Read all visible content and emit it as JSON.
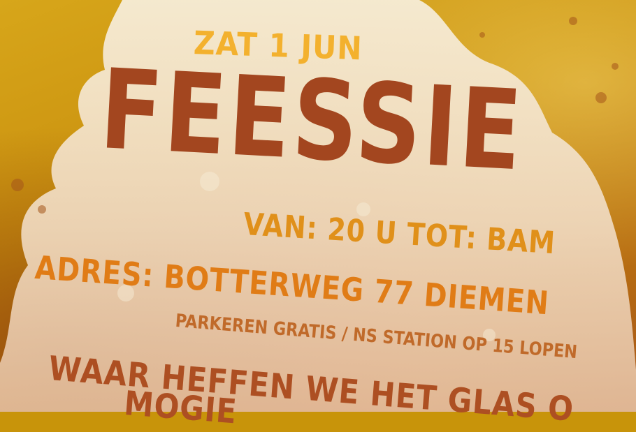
{
  "flyer": {
    "date": "ZAT 1 JUN",
    "title": "FEESSIE",
    "time": "VAN: 20 U TOT: BAM",
    "address": "ADRES: BOTTERWEG 77 DIEMEN",
    "parking": "PARKEREN GRATIS / NS STATION OP 15 LOPEN",
    "question_line1": "WAAR HEFFEN WE HET GLAS O",
    "question_line2": "MOGIE"
  },
  "colors": {
    "background": "#c8940a",
    "panel": "#f3e7cf",
    "date": "#f3b12e",
    "title": "#a3461f",
    "accent": "#e07c16"
  }
}
